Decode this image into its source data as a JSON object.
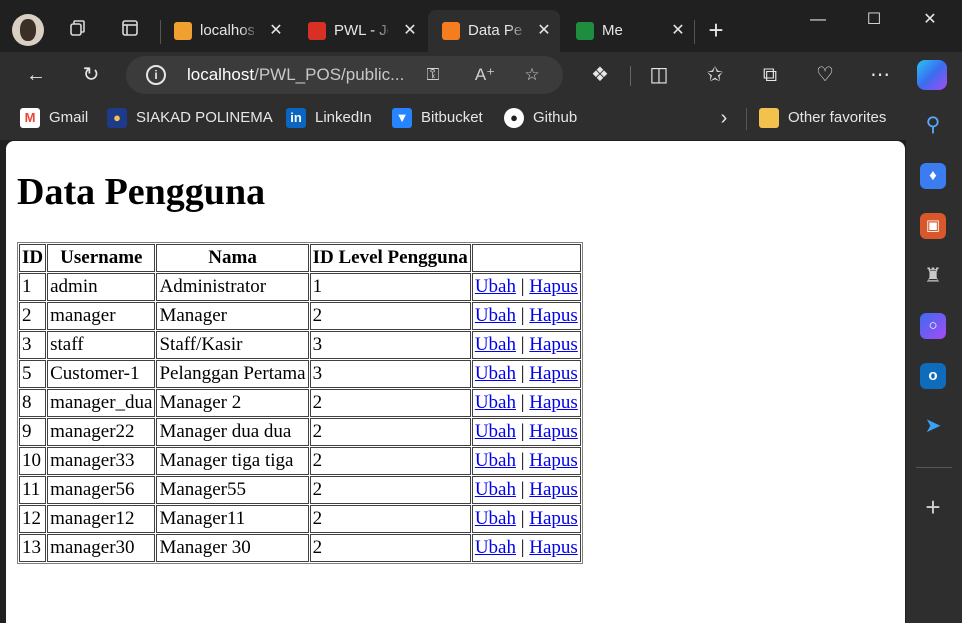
{
  "tabs": [
    {
      "title": "localhost",
      "favicon": "phpmyadmin-icon",
      "active": false
    },
    {
      "title": "PWL - Jo",
      "favicon": "pdf-icon",
      "active": false
    },
    {
      "title": "Data Per",
      "favicon": "xampp-icon",
      "active": true
    },
    {
      "title": "Me",
      "favicon": "meet-icon",
      "active": false
    }
  ],
  "address_bar": {
    "url_host": "localhost",
    "url_path": "/PWL_POS/public..."
  },
  "favorites": [
    {
      "label": "Gmail",
      "icon": "gmail-icon"
    },
    {
      "label": "SIAKAD POLINEMA",
      "icon": "polinema-icon"
    },
    {
      "label": "LinkedIn",
      "icon": "linkedin-icon"
    },
    {
      "label": "Bitbucket",
      "icon": "bitbucket-icon"
    },
    {
      "label": "Github",
      "icon": "github-icon"
    }
  ],
  "other_favorites": "Other favorites",
  "page": {
    "heading": "Data Pengguna",
    "table": {
      "headers": [
        "ID",
        "Username",
        "Nama",
        "ID Level Pengguna",
        ""
      ],
      "action_edit": "Ubah",
      "action_sep": "|",
      "action_delete": "Hapus",
      "rows": [
        {
          "id": "1",
          "username": "admin",
          "nama": "Administrator",
          "level": "1"
        },
        {
          "id": "2",
          "username": "manager",
          "nama": "Manager",
          "level": "2"
        },
        {
          "id": "3",
          "username": "staff",
          "nama": "Staff/Kasir",
          "level": "3"
        },
        {
          "id": "5",
          "username": "Customer-1",
          "nama": "Pelanggan Pertama",
          "level": "3"
        },
        {
          "id": "8",
          "username": "manager_dua",
          "nama": "Manager 2",
          "level": "2"
        },
        {
          "id": "9",
          "username": "manager22",
          "nama": "Manager dua dua",
          "level": "2"
        },
        {
          "id": "10",
          "username": "manager33",
          "nama": "Manager tiga tiga",
          "level": "2"
        },
        {
          "id": "11",
          "username": "manager56",
          "nama": "Manager55",
          "level": "2"
        },
        {
          "id": "12",
          "username": "manager12",
          "nama": "Manager11",
          "level": "2"
        },
        {
          "id": "13",
          "username": "manager30",
          "nama": "Manager 30",
          "level": "2"
        }
      ]
    }
  },
  "colors": {
    "chrome_dark": "#202020",
    "toolbar": "#2e2e2e",
    "link": "#0000ee"
  }
}
